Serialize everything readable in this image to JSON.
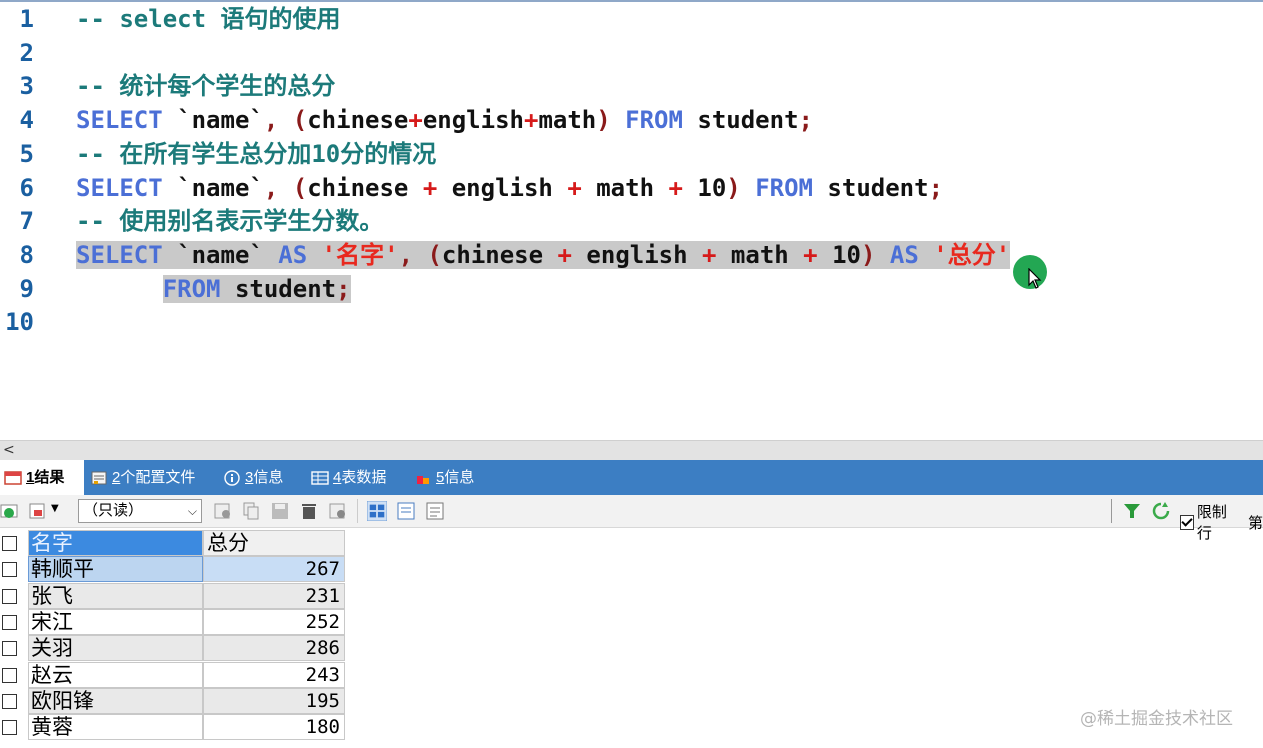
{
  "editor": {
    "lines": [
      {
        "num": "1",
        "parts": [
          {
            "t": "-- select 语句的使用",
            "c": "cm"
          }
        ]
      },
      {
        "num": "2",
        "parts": []
      },
      {
        "num": "3",
        "parts": [
          {
            "t": "-- 统计每个学生的总分",
            "c": "cm"
          }
        ]
      },
      {
        "num": "4",
        "parts": [
          {
            "t": "SELECT",
            "c": "kw"
          },
          {
            "t": " `name`",
            "c": ""
          },
          {
            "t": ",",
            "c": "pn"
          },
          {
            "t": " ",
            "c": ""
          },
          {
            "t": "(",
            "c": "pn"
          },
          {
            "t": "chinese",
            "c": ""
          },
          {
            "t": "+",
            "c": "op"
          },
          {
            "t": "english",
            "c": ""
          },
          {
            "t": "+",
            "c": "op"
          },
          {
            "t": "math",
            "c": ""
          },
          {
            "t": ")",
            "c": "pn"
          },
          {
            "t": " ",
            "c": ""
          },
          {
            "t": "FROM",
            "c": "kw"
          },
          {
            "t": " student",
            "c": ""
          },
          {
            "t": ";",
            "c": "pn"
          }
        ]
      },
      {
        "num": "5",
        "parts": [
          {
            "t": "-- 在所有学生总分加10分的情况",
            "c": "cm"
          }
        ]
      },
      {
        "num": "6",
        "parts": [
          {
            "t": "SELECT",
            "c": "kw"
          },
          {
            "t": " `name`",
            "c": ""
          },
          {
            "t": ",",
            "c": "pn"
          },
          {
            "t": " ",
            "c": ""
          },
          {
            "t": "(",
            "c": "pn"
          },
          {
            "t": "chinese ",
            "c": ""
          },
          {
            "t": "+",
            "c": "op"
          },
          {
            "t": " english ",
            "c": ""
          },
          {
            "t": "+",
            "c": "op"
          },
          {
            "t": " math ",
            "c": ""
          },
          {
            "t": "+",
            "c": "op"
          },
          {
            "t": " 10",
            "c": ""
          },
          {
            "t": ")",
            "c": "pn"
          },
          {
            "t": " ",
            "c": ""
          },
          {
            "t": "FROM",
            "c": "kw"
          },
          {
            "t": " student",
            "c": ""
          },
          {
            "t": ";",
            "c": "pn"
          }
        ]
      },
      {
        "num": "7",
        "parts": [
          {
            "t": "-- 使用别名表示学生分数。",
            "c": "cm"
          }
        ]
      },
      {
        "num": "8",
        "sel": true,
        "parts": [
          {
            "t": "SELECT",
            "c": "kw"
          },
          {
            "t": " `name` ",
            "c": ""
          },
          {
            "t": "AS",
            "c": "kw"
          },
          {
            "t": " ",
            "c": ""
          },
          {
            "t": "'名字'",
            "c": "str"
          },
          {
            "t": ",",
            "c": "pn"
          },
          {
            "t": " ",
            "c": ""
          },
          {
            "t": "(",
            "c": "pn"
          },
          {
            "t": "chinese ",
            "c": ""
          },
          {
            "t": "+",
            "c": "op"
          },
          {
            "t": " english ",
            "c": ""
          },
          {
            "t": "+",
            "c": "op"
          },
          {
            "t": " math ",
            "c": ""
          },
          {
            "t": "+",
            "c": "op"
          },
          {
            "t": " 10",
            "c": ""
          },
          {
            "t": ")",
            "c": "pn"
          },
          {
            "t": " ",
            "c": ""
          },
          {
            "t": "AS",
            "c": "kw"
          },
          {
            "t": " ",
            "c": ""
          },
          {
            "t": "'总分'",
            "c": "str"
          }
        ]
      },
      {
        "num": "9",
        "sel": true,
        "parts": [
          {
            "t": "      ",
            "c": "nosel"
          },
          {
            "t": "FROM",
            "c": "kw"
          },
          {
            "t": " student",
            "c": ""
          },
          {
            "t": ";",
            "c": "pn"
          }
        ]
      },
      {
        "num": "10",
        "parts": []
      }
    ]
  },
  "scrollbar": {
    "left_arrow": "<"
  },
  "tabs": [
    {
      "label_num": "1",
      "label": " 结果",
      "active": true,
      "icon": "table-result-icon"
    },
    {
      "label_num": "2",
      "label": " 个配置文件",
      "active": false,
      "icon": "profile-icon"
    },
    {
      "label_num": "3",
      "label": " 信息",
      "active": false,
      "icon": "info-icon"
    },
    {
      "label_num": "4",
      "label": " 表数据",
      "active": false,
      "icon": "table-data-icon"
    },
    {
      "label_num": "5",
      "label": " 信息",
      "active": false,
      "icon": "info2-icon"
    }
  ],
  "toolbar": {
    "mode_select": "（只读）",
    "limit_label": "限制行",
    "limit_checked": true,
    "truncated_char": "第"
  },
  "grid": {
    "columns": [
      "名字",
      "总分"
    ],
    "rows": [
      {
        "name": "韩顺平",
        "total": "267"
      },
      {
        "name": "张飞",
        "total": "231"
      },
      {
        "name": "宋江",
        "total": "252"
      },
      {
        "name": "关羽",
        "total": "286"
      },
      {
        "name": "赵云",
        "total": "243"
      },
      {
        "name": "欧阳锋",
        "total": "195"
      },
      {
        "name": "黄蓉",
        "total": "180"
      }
    ]
  },
  "watermark": "@稀土掘金技术社区",
  "colors": {
    "accent": "#3c7ec3",
    "comment": "#1c7a7a",
    "keyword": "#4b6fd6",
    "string": "#e8281e"
  }
}
